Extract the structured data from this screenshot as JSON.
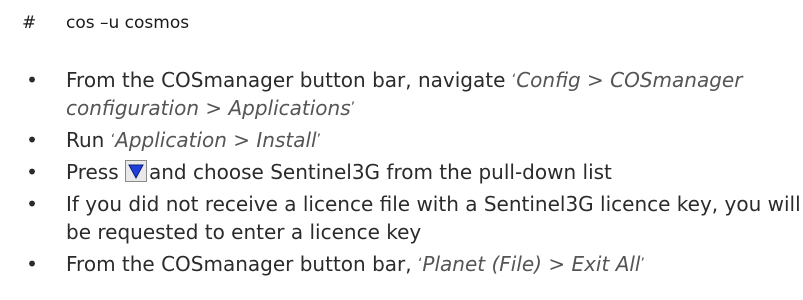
{
  "command": {
    "prompt": "#",
    "text": "cos –u cosmos"
  },
  "steps": [
    {
      "before": "From the COSmanager button bar, navigate ",
      "quote_open": "‘",
      "path": "Config > COSmanager configuration > Applications",
      "quote_close": "’",
      "after": ""
    },
    {
      "before": "Run ",
      "quote_open": "‘",
      "path": "Application > Install",
      "quote_close": "’",
      "after": ""
    },
    {
      "before": "Press ",
      "icon": "dropdown-arrow-icon",
      "after": "and choose Sentinel3G from the pull-down list"
    },
    {
      "text": "If you did not receive a licence file with a Sentinel3G licence key, you will be requested to enter a licence key"
    },
    {
      "before": "From the COSmanager button bar, ",
      "quote_open": "‘",
      "path": "Planet (File) > Exit All",
      "quote_close": "’",
      "after": ""
    }
  ],
  "colors": {
    "text": "#2b2b2b",
    "italic_text": "#555555",
    "icon_arrow": "#1f3fd8",
    "icon_button_bg": "#e9e9e9"
  }
}
